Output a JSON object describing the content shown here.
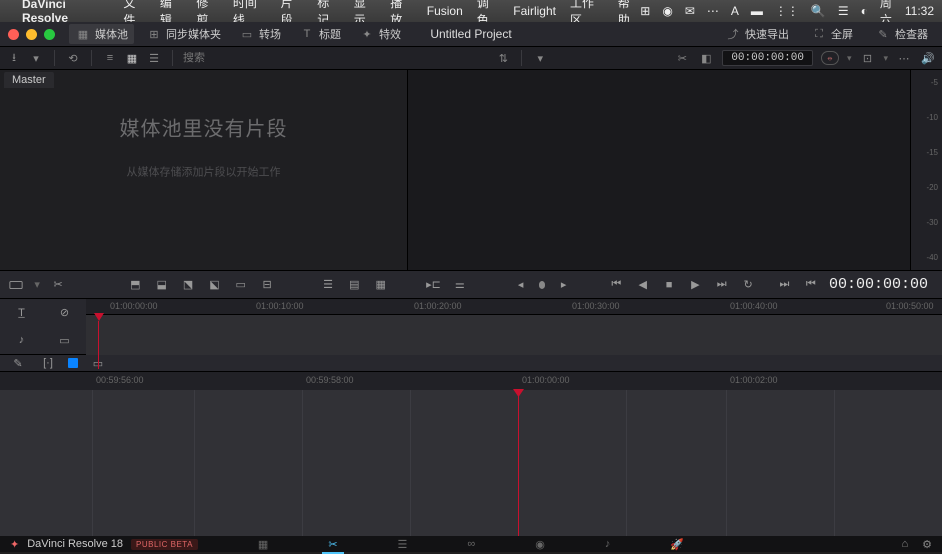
{
  "menubar": {
    "app": "DaVinci Resolve",
    "items": [
      "文件",
      "编辑",
      "修剪",
      "时间线",
      "片段",
      "标记",
      "显示",
      "播放",
      "Fusion",
      "调色",
      "Fairlight",
      "工作区",
      "帮助"
    ],
    "clock_day": "周六",
    "clock_time": "11:32"
  },
  "titlebar": {
    "project": "Untitled Project",
    "tabs": {
      "mediapool": "媒体池",
      "syncbin": "同步媒体夹",
      "transitions": "转场",
      "titles": "标题",
      "effects": "特效"
    },
    "quick_export": "快速导出",
    "fullscreen": "全屏",
    "inspector": "检查器"
  },
  "toolbar": {
    "search_placeholder": "搜索",
    "sort_label": "",
    "timecode": "00:00:00:00"
  },
  "mediapool": {
    "master": "Master",
    "empty_title": "媒体池里没有片段",
    "empty_sub": "从媒体存储添加片段以开始工作"
  },
  "meter_scale": [
    "-5",
    "-10",
    "-15",
    "-20",
    "-30",
    "-40"
  ],
  "transport": {
    "big_timecode": "00:00:00:00"
  },
  "upper_ruler": [
    "01:00:00:00",
    "01:00:10:00",
    "01:00:20:00",
    "01:00:30:00",
    "01:00:40:00",
    "01:00:50:00"
  ],
  "lower_ruler": [
    "00:59:56:00",
    "00:59:58:00",
    "01:00:00:00",
    "01:00:02:00"
  ],
  "pagebar": {
    "brand": "DaVinci Resolve 18",
    "beta": "PUBLIC BETA"
  }
}
